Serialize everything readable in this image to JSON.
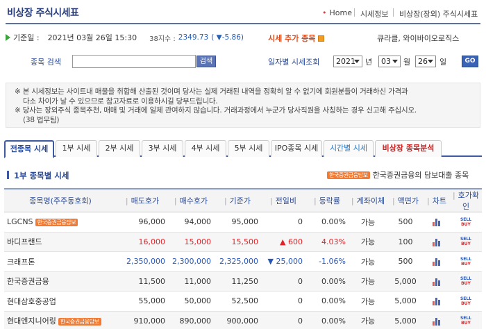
{
  "header": {
    "title": "비상장 주식시세표",
    "breadcrumb": [
      "Home",
      "시세정보",
      "비상장(장외) 주식시세표"
    ]
  },
  "info": {
    "base_label": "기준일 :",
    "base_date": "2021년 03월 26일 15:30",
    "index_label": "38지수 :",
    "index_value": "2349.73",
    "index_change": "( ▼-5.86)",
    "add_link": "시세 추가 종목",
    "notice_company": "큐라클, 와이바이오로직스"
  },
  "search": {
    "label": "종목 검색",
    "value": "",
    "placeholder": "",
    "button": "검색"
  },
  "date_query": {
    "label": "일자별 시세조회",
    "year": "2021",
    "month": "03",
    "day": "26",
    "year_unit": "년",
    "month_unit": "월",
    "day_unit": "일",
    "go": "GO"
  },
  "notice": [
    "※ 본 시세정보는 사이트내 매물을 취합해 산출된 것이며 당사는 실제 거래된 내역을 정확히 알 수 없기에 회원분들이 거래하신 가격과",
    "다소 차이가 날 수 있으므로 참고자료로 이용하시길 당부드립니다.",
    "※ 당사는 장외주식 종목추천, 매매 및 거래에 일체 관여하지 않습니다. 거래과정에서 누군가 당사직원을 사칭하는 경우 신고해 주십시오.",
    "(38 법무팀)"
  ],
  "tabs": [
    {
      "label": "전종목 시세"
    },
    {
      "label": "1부 시세"
    },
    {
      "label": "2부 시세"
    },
    {
      "label": "3부 시세"
    },
    {
      "label": "4부 시세"
    },
    {
      "label": "5부 시세"
    },
    {
      "label": "IPO종목 시세"
    },
    {
      "label": "시간별 시세"
    },
    {
      "label": "비상장 종목분석"
    }
  ],
  "section": {
    "title": "1부 종목별 시세",
    "badge": "한국증권금융담보",
    "legend": "한국증권금융의 담보대출 종목"
  },
  "table": {
    "headers": [
      "종목명(주주동호회)",
      "매도호가",
      "매수호가",
      "기준가",
      "전일비",
      "등락률",
      "계좌이체",
      "액면가",
      "차트",
      "호가확인"
    ],
    "rows": [
      {
        "name": "LGCNS",
        "badge": "한국증권금융담보",
        "ask": "96,000",
        "bid": "94,000",
        "base": "95,000",
        "diff": "0",
        "rate": "0.00%",
        "transfer": "가능",
        "par": "500"
      },
      {
        "name": "바디프랜드",
        "badge": "",
        "ask": "16,000",
        "bid": "15,000",
        "base": "15,500",
        "diff": "600",
        "rate": "4.03%",
        "transfer": "가능",
        "par": "100",
        "trend": "up"
      },
      {
        "name": "크래프톤",
        "badge": "",
        "ask": "2,350,000",
        "bid": "2,300,000",
        "base": "2,325,000",
        "diff": "25,000",
        "rate": "-1.06%",
        "transfer": "가능",
        "par": "500",
        "trend": "down"
      },
      {
        "name": "한국증권금융",
        "badge": "",
        "ask": "11,500",
        "bid": "11,000",
        "base": "11,250",
        "diff": "0",
        "rate": "0.00%",
        "transfer": "가능",
        "par": "5,000"
      },
      {
        "name": "현대삼호중공업",
        "badge": "",
        "ask": "55,000",
        "bid": "50,000",
        "base": "52,500",
        "diff": "0",
        "rate": "0.00%",
        "transfer": "가능",
        "par": "5,000"
      },
      {
        "name": "현대엔지니어링",
        "badge": "한국증권금융담보",
        "ask": "910,000",
        "bid": "890,000",
        "base": "900,000",
        "diff": "0",
        "rate": "0.00%",
        "transfer": "가능",
        "par": "5,000"
      }
    ],
    "sell_label": "SELL",
    "buy_label": "BUY"
  },
  "colors": {
    "up": "#e0252a",
    "down": "#2756b7",
    "accent": "#3d5aa0",
    "badge": "#f07b35"
  }
}
